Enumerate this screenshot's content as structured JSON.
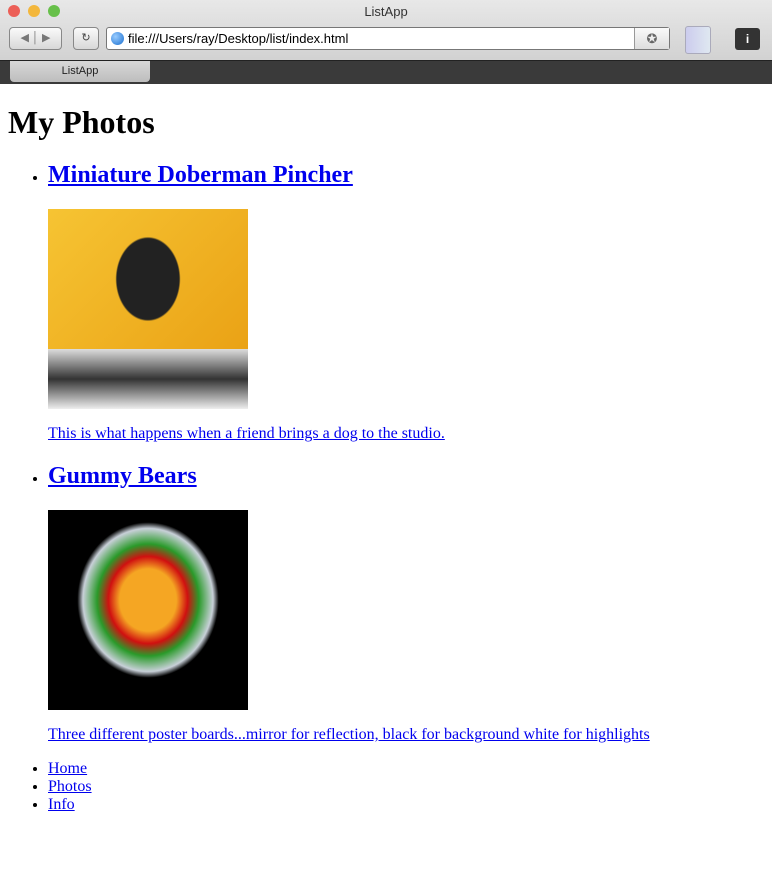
{
  "window": {
    "title": "ListApp",
    "url": "file:///Users/ray/Desktop/list/index.html",
    "tab": "ListApp"
  },
  "page": {
    "title": "My Photos",
    "items": [
      {
        "title": "Miniature Doberman Pincher",
        "caption": "This is what happens when a friend brings a dog to the studio."
      },
      {
        "title": "Gummy Bears",
        "caption": "Three different poster boards...mirror for reflection, black for background white for highlights"
      }
    ],
    "nav": [
      "Home",
      "Photos",
      "Info"
    ]
  }
}
